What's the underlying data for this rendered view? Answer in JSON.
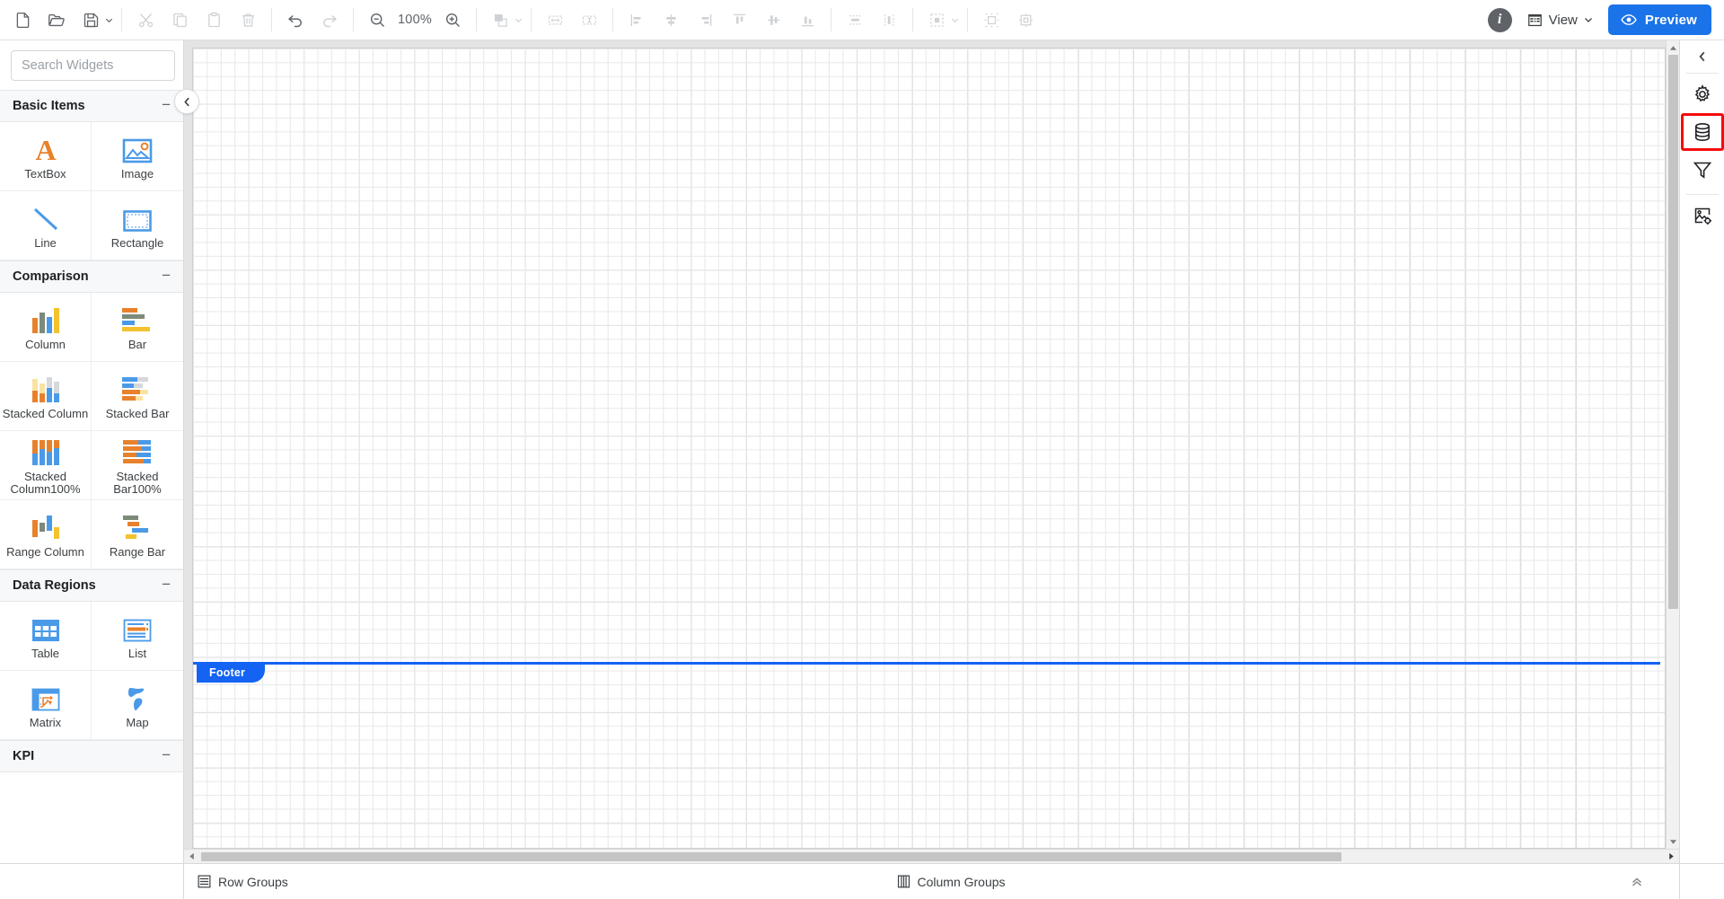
{
  "toolbar": {
    "groups": [
      {
        "name": "file",
        "buttons": [
          {
            "name": "new-report-button",
            "icon": "new-file-icon",
            "disabled": false,
            "caret": false
          },
          {
            "name": "open-report-button",
            "icon": "open-folder-icon",
            "disabled": false,
            "caret": false
          },
          {
            "name": "save-report-button",
            "icon": "save-disk-icon",
            "disabled": false,
            "caret": true
          }
        ]
      },
      {
        "name": "clipboard",
        "buttons": [
          {
            "name": "cut-button",
            "icon": "scissors-icon",
            "disabled": true,
            "caret": false
          },
          {
            "name": "copy-button",
            "icon": "copy-icon",
            "disabled": true,
            "caret": false
          },
          {
            "name": "paste-button",
            "icon": "paste-icon",
            "disabled": true,
            "caret": false
          },
          {
            "name": "delete-button",
            "icon": "trash-icon",
            "disabled": true,
            "caret": false
          }
        ]
      },
      {
        "name": "history",
        "buttons": [
          {
            "name": "undo-button",
            "icon": "undo-arrow-icon",
            "disabled": false,
            "caret": false
          },
          {
            "name": "redo-button",
            "icon": "redo-arrow-icon",
            "disabled": true,
            "caret": false
          }
        ]
      },
      {
        "name": "zoom",
        "buttons": [
          {
            "name": "zoom-out-button",
            "icon": "zoom-out-icon",
            "disabled": false,
            "caret": false
          }
        ]
      },
      {
        "name": "zoom2",
        "buttons": [
          {
            "name": "zoom-in-button",
            "icon": "zoom-in-icon",
            "disabled": false,
            "caret": false
          }
        ]
      },
      {
        "name": "arrange",
        "buttons": [
          {
            "name": "bring-to-front-button",
            "icon": "layers-order-icon",
            "disabled": true,
            "caret": true
          }
        ]
      },
      {
        "name": "size",
        "buttons": [
          {
            "name": "make-same-width-button",
            "icon": "same-width-icon",
            "disabled": true,
            "caret": false
          },
          {
            "name": "make-same-height-button",
            "icon": "same-height-icon",
            "disabled": true,
            "caret": false
          }
        ]
      },
      {
        "name": "align-horizontal",
        "buttons": [
          {
            "name": "align-left-button",
            "icon": "align-left-icon",
            "disabled": true,
            "caret": false
          },
          {
            "name": "align-center-button",
            "icon": "align-center-icon",
            "disabled": true,
            "caret": false
          },
          {
            "name": "align-right-button",
            "icon": "align-right-icon",
            "disabled": true,
            "caret": false
          },
          {
            "name": "align-top-button",
            "icon": "align-top-icon",
            "disabled": true,
            "caret": false
          },
          {
            "name": "align-middle-button",
            "icon": "align-middle-icon",
            "disabled": true,
            "caret": false
          },
          {
            "name": "align-bottom-button",
            "icon": "align-bottom-icon",
            "disabled": true,
            "caret": false
          }
        ]
      },
      {
        "name": "distribute",
        "buttons": [
          {
            "name": "distribute-vertically-button",
            "icon": "distribute-vertical-icon",
            "disabled": true,
            "caret": false
          },
          {
            "name": "distribute-horizontally-button",
            "icon": "distribute-horizontal-icon",
            "disabled": true,
            "caret": false
          }
        ]
      },
      {
        "name": "select",
        "buttons": [
          {
            "name": "selection-mode-button",
            "icon": "selection-marquee-icon",
            "disabled": true,
            "caret": true
          }
        ]
      },
      {
        "name": "spacing",
        "buttons": [
          {
            "name": "increase-spacing-button",
            "icon": "expand-spacing-icon",
            "disabled": true,
            "caret": false
          },
          {
            "name": "decrease-spacing-button",
            "icon": "collapse-spacing-icon",
            "disabled": true,
            "caret": false
          }
        ]
      }
    ],
    "zoom_level": "100%",
    "info_label": "i",
    "view_label": "View",
    "preview_label": "Preview"
  },
  "left_panel": {
    "search": {
      "placeholder": "Search Widgets",
      "value": "",
      "icon": "search-icon"
    },
    "collapse_icon": "chevron-left-icon",
    "sections": [
      {
        "title": "Basic Items",
        "toggle": "−",
        "items": [
          {
            "label": "TextBox",
            "icon": "textbox-icon"
          },
          {
            "label": "Image",
            "icon": "image-icon"
          },
          {
            "label": "Line",
            "icon": "line-icon"
          },
          {
            "label": "Rectangle",
            "icon": "rectangle-icon"
          }
        ]
      },
      {
        "title": "Comparison",
        "toggle": "−",
        "items": [
          {
            "label": "Column",
            "icon": "column-chart-icon"
          },
          {
            "label": "Bar",
            "icon": "bar-chart-icon"
          },
          {
            "label": "Stacked Column",
            "icon": "stacked-column-chart-icon"
          },
          {
            "label": "Stacked Bar",
            "icon": "stacked-bar-chart-icon"
          },
          {
            "label": "Stacked Column100%",
            "icon": "stacked-column-100-chart-icon"
          },
          {
            "label": "Stacked Bar100%",
            "icon": "stacked-bar-100-chart-icon"
          },
          {
            "label": "Range Column",
            "icon": "range-column-chart-icon"
          },
          {
            "label": "Range Bar",
            "icon": "range-bar-chart-icon"
          }
        ]
      },
      {
        "title": "Data Regions",
        "toggle": "−",
        "items": [
          {
            "label": "Table",
            "icon": "table-icon"
          },
          {
            "label": "List",
            "icon": "list-icon"
          },
          {
            "label": "Matrix",
            "icon": "matrix-icon"
          },
          {
            "label": "Map",
            "icon": "map-icon"
          }
        ]
      },
      {
        "title": "KPI",
        "toggle": "−",
        "items": []
      }
    ]
  },
  "canvas": {
    "footer_label": "Footer",
    "scroll_up_icon": "scroll-up-arrow-icon",
    "scroll_down_icon": "scroll-down-arrow-icon",
    "scroll_left_icon": "scroll-left-arrow-icon",
    "scroll_right_icon": "scroll-right-arrow-icon"
  },
  "right_rail": {
    "collapse_icon": "chevron-left-icon",
    "buttons": [
      {
        "name": "report-properties-button",
        "icon": "gear-icon",
        "highlighted": false
      },
      {
        "name": "data-sources-button",
        "icon": "database-icon",
        "highlighted": true
      },
      {
        "name": "filters-button",
        "icon": "funnel-icon",
        "highlighted": false
      },
      {
        "name": "resources-button",
        "icon": "image-settings-icon",
        "highlighted": false
      }
    ]
  },
  "bottom_bar": {
    "row_groups_label": "Row Groups",
    "row_groups_icon": "row-groups-icon",
    "column_groups_label": "Column Groups",
    "column_groups_icon": "column-groups-icon",
    "collapse_icon": "double-chevron-up-icon"
  },
  "colors": {
    "accent": "#1a73e8",
    "footer_band": "#1463f3",
    "highlight_box": "#f60b0b",
    "chart_orange": "#e8812c",
    "chart_blue": "#4a9ae8",
    "chart_yellow": "#f2c230",
    "chart_gray": "#7d8a79"
  }
}
